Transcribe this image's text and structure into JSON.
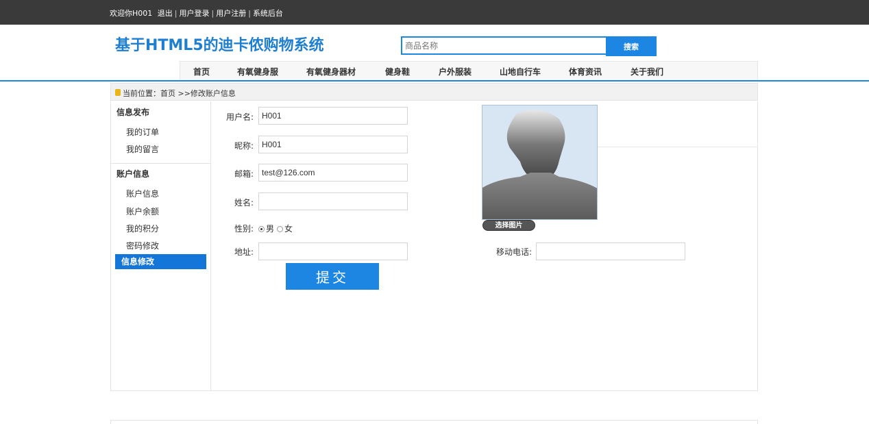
{
  "topbar": {
    "welcome": "欢迎你H001",
    "logout": "退出",
    "login": "用户登录",
    "register": "用户注册",
    "admin": "系统后台",
    "separator": "|"
  },
  "header": {
    "logo_text": "基于HTML5的迪卡侬购物系统",
    "search_placeholder": "商品名称",
    "search_button": "搜索"
  },
  "nav": {
    "items": [
      "首页",
      "有氧健身服",
      "有氧健身器材",
      "健身鞋",
      "户外服装",
      "山地自行车",
      "体育资讯",
      "关于我们"
    ]
  },
  "breadcrumb": {
    "text": "当前位置：首页 >>修改账户信息"
  },
  "sidebar": {
    "section1": "信息发布",
    "orders": "我的订单",
    "messages": "我的留言",
    "section2": "账户信息",
    "account_info": "账户信息",
    "balance": "账户余额",
    "points": "我的积分",
    "password": "密码修改",
    "info_edit": "信息修改"
  },
  "form": {
    "username_label": "用户名:",
    "username_value": "H001",
    "nickname_label": "昵称:",
    "nickname_value": "H001",
    "email_label": "邮箱:",
    "email_value": "test@126.com",
    "name_label": "姓名:",
    "name_value": "",
    "gender_label": "性别:",
    "gender_male": "男",
    "gender_female": "女",
    "gender_selected": "男",
    "address_label": "地址:",
    "address_value": "",
    "phone_label": "移动电话:",
    "phone_value": "",
    "submit": "提交",
    "choose_image": "选择图片"
  },
  "colors": {
    "brand_blue": "#1d86e3",
    "active_blue": "#1476d8",
    "topbar": "#3a3a3a"
  }
}
